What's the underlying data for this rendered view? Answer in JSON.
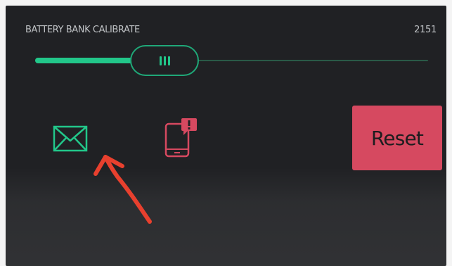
{
  "slider": {
    "title": "BATTERY BANK CALIBRATE",
    "value": "2151",
    "fill_fraction": 0.33,
    "accent_color": "#22c78a",
    "track_color": "#2a5a48"
  },
  "widgets": {
    "mail_icon": "mail-icon",
    "mail_color": "#22c78a",
    "phone_icon": "phone-notification-icon",
    "phone_color": "#d64960"
  },
  "reset": {
    "label": "Reset",
    "color": "#d64960"
  },
  "annotation": {
    "arrow_color": "#e8402e"
  }
}
